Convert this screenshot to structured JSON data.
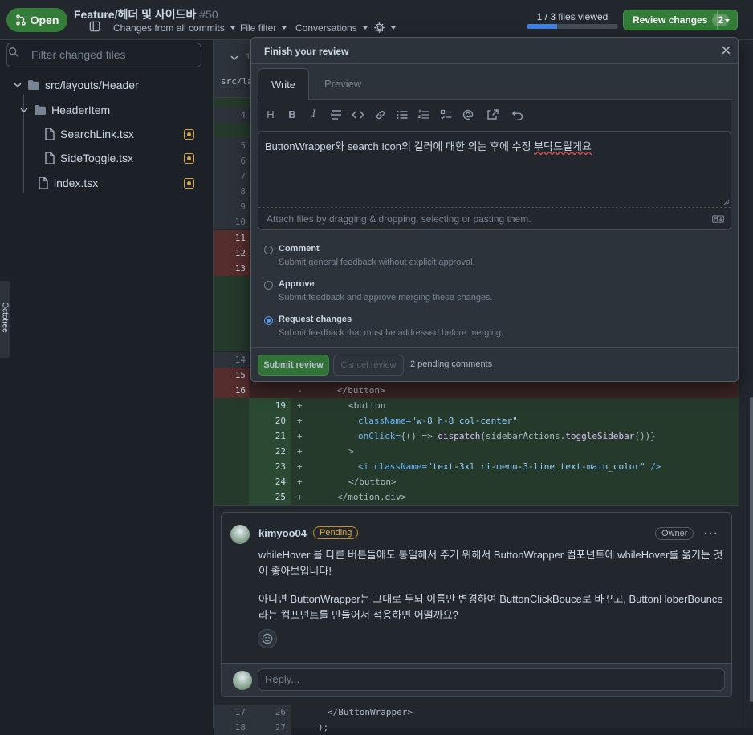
{
  "header": {
    "status": "Open",
    "title": "Feature/헤더 및 사이드바",
    "number": "#50",
    "changes_from": "Changes from all commits",
    "file_filter": "File filter",
    "conversations": "Conversations",
    "files_viewed": "1 / 3 files viewed",
    "files_viewed_progress": 0.333,
    "review_button": "Review changes",
    "review_count": "2"
  },
  "sidebar": {
    "filter_placeholder": "Filter changed files",
    "tree": [
      {
        "label": "src/layouts/Header",
        "type": "folder"
      },
      {
        "label": "HeaderItem",
        "type": "folder"
      },
      {
        "label": "SearchLink.tsx",
        "type": "file"
      },
      {
        "label": "SideToggle.tsx",
        "type": "file"
      },
      {
        "label": "index.tsx",
        "type": "file"
      }
    ],
    "octotree_label": "Octotree"
  },
  "diff": {
    "path_fragment": "src/la",
    "collapse_num": "1",
    "rows_context": [
      {
        "old": "4",
        "new": ""
      },
      {
        "old": "5",
        "new": ""
      },
      {
        "old": "6",
        "new": ""
      },
      {
        "old": "7",
        "new": ""
      },
      {
        "old": "8",
        "new": ""
      },
      {
        "old": "9",
        "new": ""
      },
      {
        "old": "10",
        "new": ""
      },
      {
        "old": "11",
        "new": ""
      },
      {
        "old": "12",
        "new": ""
      },
      {
        "old": "13",
        "new": ""
      },
      {
        "old": "14",
        "new": ""
      },
      {
        "old": "15",
        "new": ""
      },
      {
        "old": "16",
        "new": ""
      }
    ],
    "line16_sign": "-",
    "line16_code": "</button>",
    "added": [
      {
        "new": "19",
        "code": "<button"
      },
      {
        "new": "20",
        "code_attr": "className=",
        "code_str": "\"w-8 h-8 col-center\""
      },
      {
        "new": "21",
        "code_attr": "onClick=",
        "code_rest": "{() => ",
        "code_fn": "dispatch",
        "code_tail": "(sidebarActions.",
        "code_fn2": "toggleSidebar",
        "code_end": "())}"
      },
      {
        "new": "22",
        "code": ">"
      },
      {
        "new": "23",
        "code_tag": "<i ",
        "code_attr": "className=",
        "code_str": "\"text-3xl ri-menu-3-line text-main_color\"",
        "code_end": " />"
      },
      {
        "new": "24",
        "code": "</button>"
      },
      {
        "new": "25",
        "code": "</motion.div>"
      }
    ],
    "after": [
      {
        "old": "17",
        "new": "26",
        "code": "</ButtonWrapper>"
      },
      {
        "old": "18",
        "new": "27",
        "code": ");"
      }
    ]
  },
  "thread": {
    "author": "kimyoo04",
    "pending": "Pending",
    "owner": "Owner",
    "more": "···",
    "para1": "whileHover 를 다른 버튼들에도 통일해서 주기 위해서 ButtonWrapper 컴포넌트에 whileHover를 옮기는 것이 좋아보입니다!",
    "para2": "아니면 ButtonWrapper는 그대로 두되 이름만 변경하여 ButtonClickBouce로 바꾸고, ButtonHoberBounce 라는 컴포넌트를 만들어서 적용하면 어떨까요?",
    "reply_placeholder": "Reply..."
  },
  "popup": {
    "title": "Finish your review",
    "tab_write": "Write",
    "tab_preview": "Preview",
    "editor_text_a": "ButtonWrapper와 search Icon의 컬러에 대한 의논 후에 수정 ",
    "editor_text_b": "부탁드릴게요",
    "attach": "Attach files by dragging & dropping, selecting or pasting them.",
    "options": [
      {
        "label": "Comment",
        "desc": "Submit general feedback without explicit approval."
      },
      {
        "label": "Approve",
        "desc": "Submit feedback and approve merging these changes."
      },
      {
        "label": "Request changes",
        "desc": "Submit feedback that must be addressed before merging."
      }
    ],
    "submit": "Submit review",
    "cancel": "Cancel review",
    "pending_comments": "2 pending comments"
  },
  "colors": {
    "accent_green": "#347d39",
    "link_blue": "#539bf5",
    "pending_yellow": "#daaa3f"
  }
}
